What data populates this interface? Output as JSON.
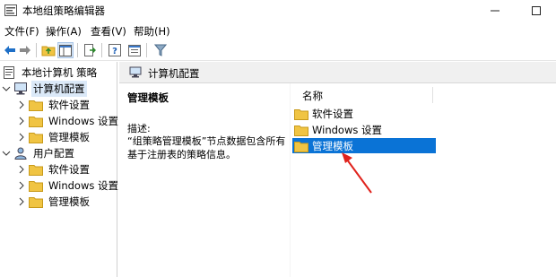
{
  "window": {
    "title": "本地组策略编辑器",
    "controls": {
      "minimize": "minimize-icon",
      "maximize": "maximize-icon"
    }
  },
  "menu": [
    "文件(F)",
    "操作(A)",
    "查看(V)",
    "帮助(H)"
  ],
  "toolbar": [
    "back-icon",
    "forward-icon",
    "up-folder-icon",
    "show-hide-tree-icon",
    "export-list-icon",
    "help-icon",
    "properties-icon",
    "filter-icon"
  ],
  "tree": {
    "root": "本地计算机 策略",
    "computer": {
      "label": "计算机配置",
      "children": [
        "软件设置",
        "Windows 设置",
        "管理模板"
      ]
    },
    "user": {
      "label": "用户配置",
      "children": [
        "软件设置",
        "Windows 设置",
        "管理模板"
      ]
    }
  },
  "right_pane": {
    "header": "计算机配置",
    "selected_title": "管理模板",
    "description_label": "描述:",
    "description_text": "“组策略管理模板”节点数据包含所有基于注册表的策略信息。",
    "column_name": "名称",
    "items": [
      "软件设置",
      "Windows 设置",
      "管理模板"
    ],
    "selected_index": 2
  },
  "colors": {
    "selection": "#0a73d6",
    "tree_selection": "#dbe9f8",
    "folder": "#f0c443",
    "arrow": "#e0221c"
  }
}
